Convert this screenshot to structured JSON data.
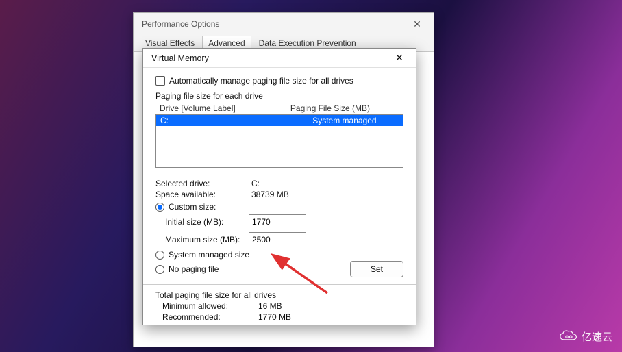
{
  "outer_window": {
    "title": "Performance Options",
    "tabs": [
      "Visual Effects",
      "Advanced",
      "Data Execution Prevention"
    ],
    "active_tab_index": 1
  },
  "inner_window": {
    "title": "Virtual Memory",
    "auto_manage_label": "Automatically manage paging file size for all drives",
    "auto_manage_checked": false,
    "section_label": "Paging file size for each drive",
    "list_header_drive": "Drive  [Volume Label]",
    "list_header_size": "Paging File Size (MB)",
    "drives": [
      {
        "label": "C:",
        "size": "System managed"
      }
    ],
    "selected_drive_label": "Selected drive:",
    "selected_drive_value": "C:",
    "space_available_label": "Space available:",
    "space_available_value": "38739 MB",
    "size_mode": "custom",
    "custom_label": "Custom size:",
    "initial_label": "Initial size (MB):",
    "initial_value": "1770",
    "max_label": "Maximum size (MB):",
    "max_value": "2500",
    "system_managed_label": "System managed size",
    "no_paging_label": "No paging file",
    "set_button": "Set",
    "total_label": "Total paging file size for all drives",
    "min_allowed_label": "Minimum allowed:",
    "min_allowed_value": "16 MB",
    "recommended_label": "Recommended:",
    "recommended_value": "1770 MB"
  },
  "watermark": "亿速云"
}
